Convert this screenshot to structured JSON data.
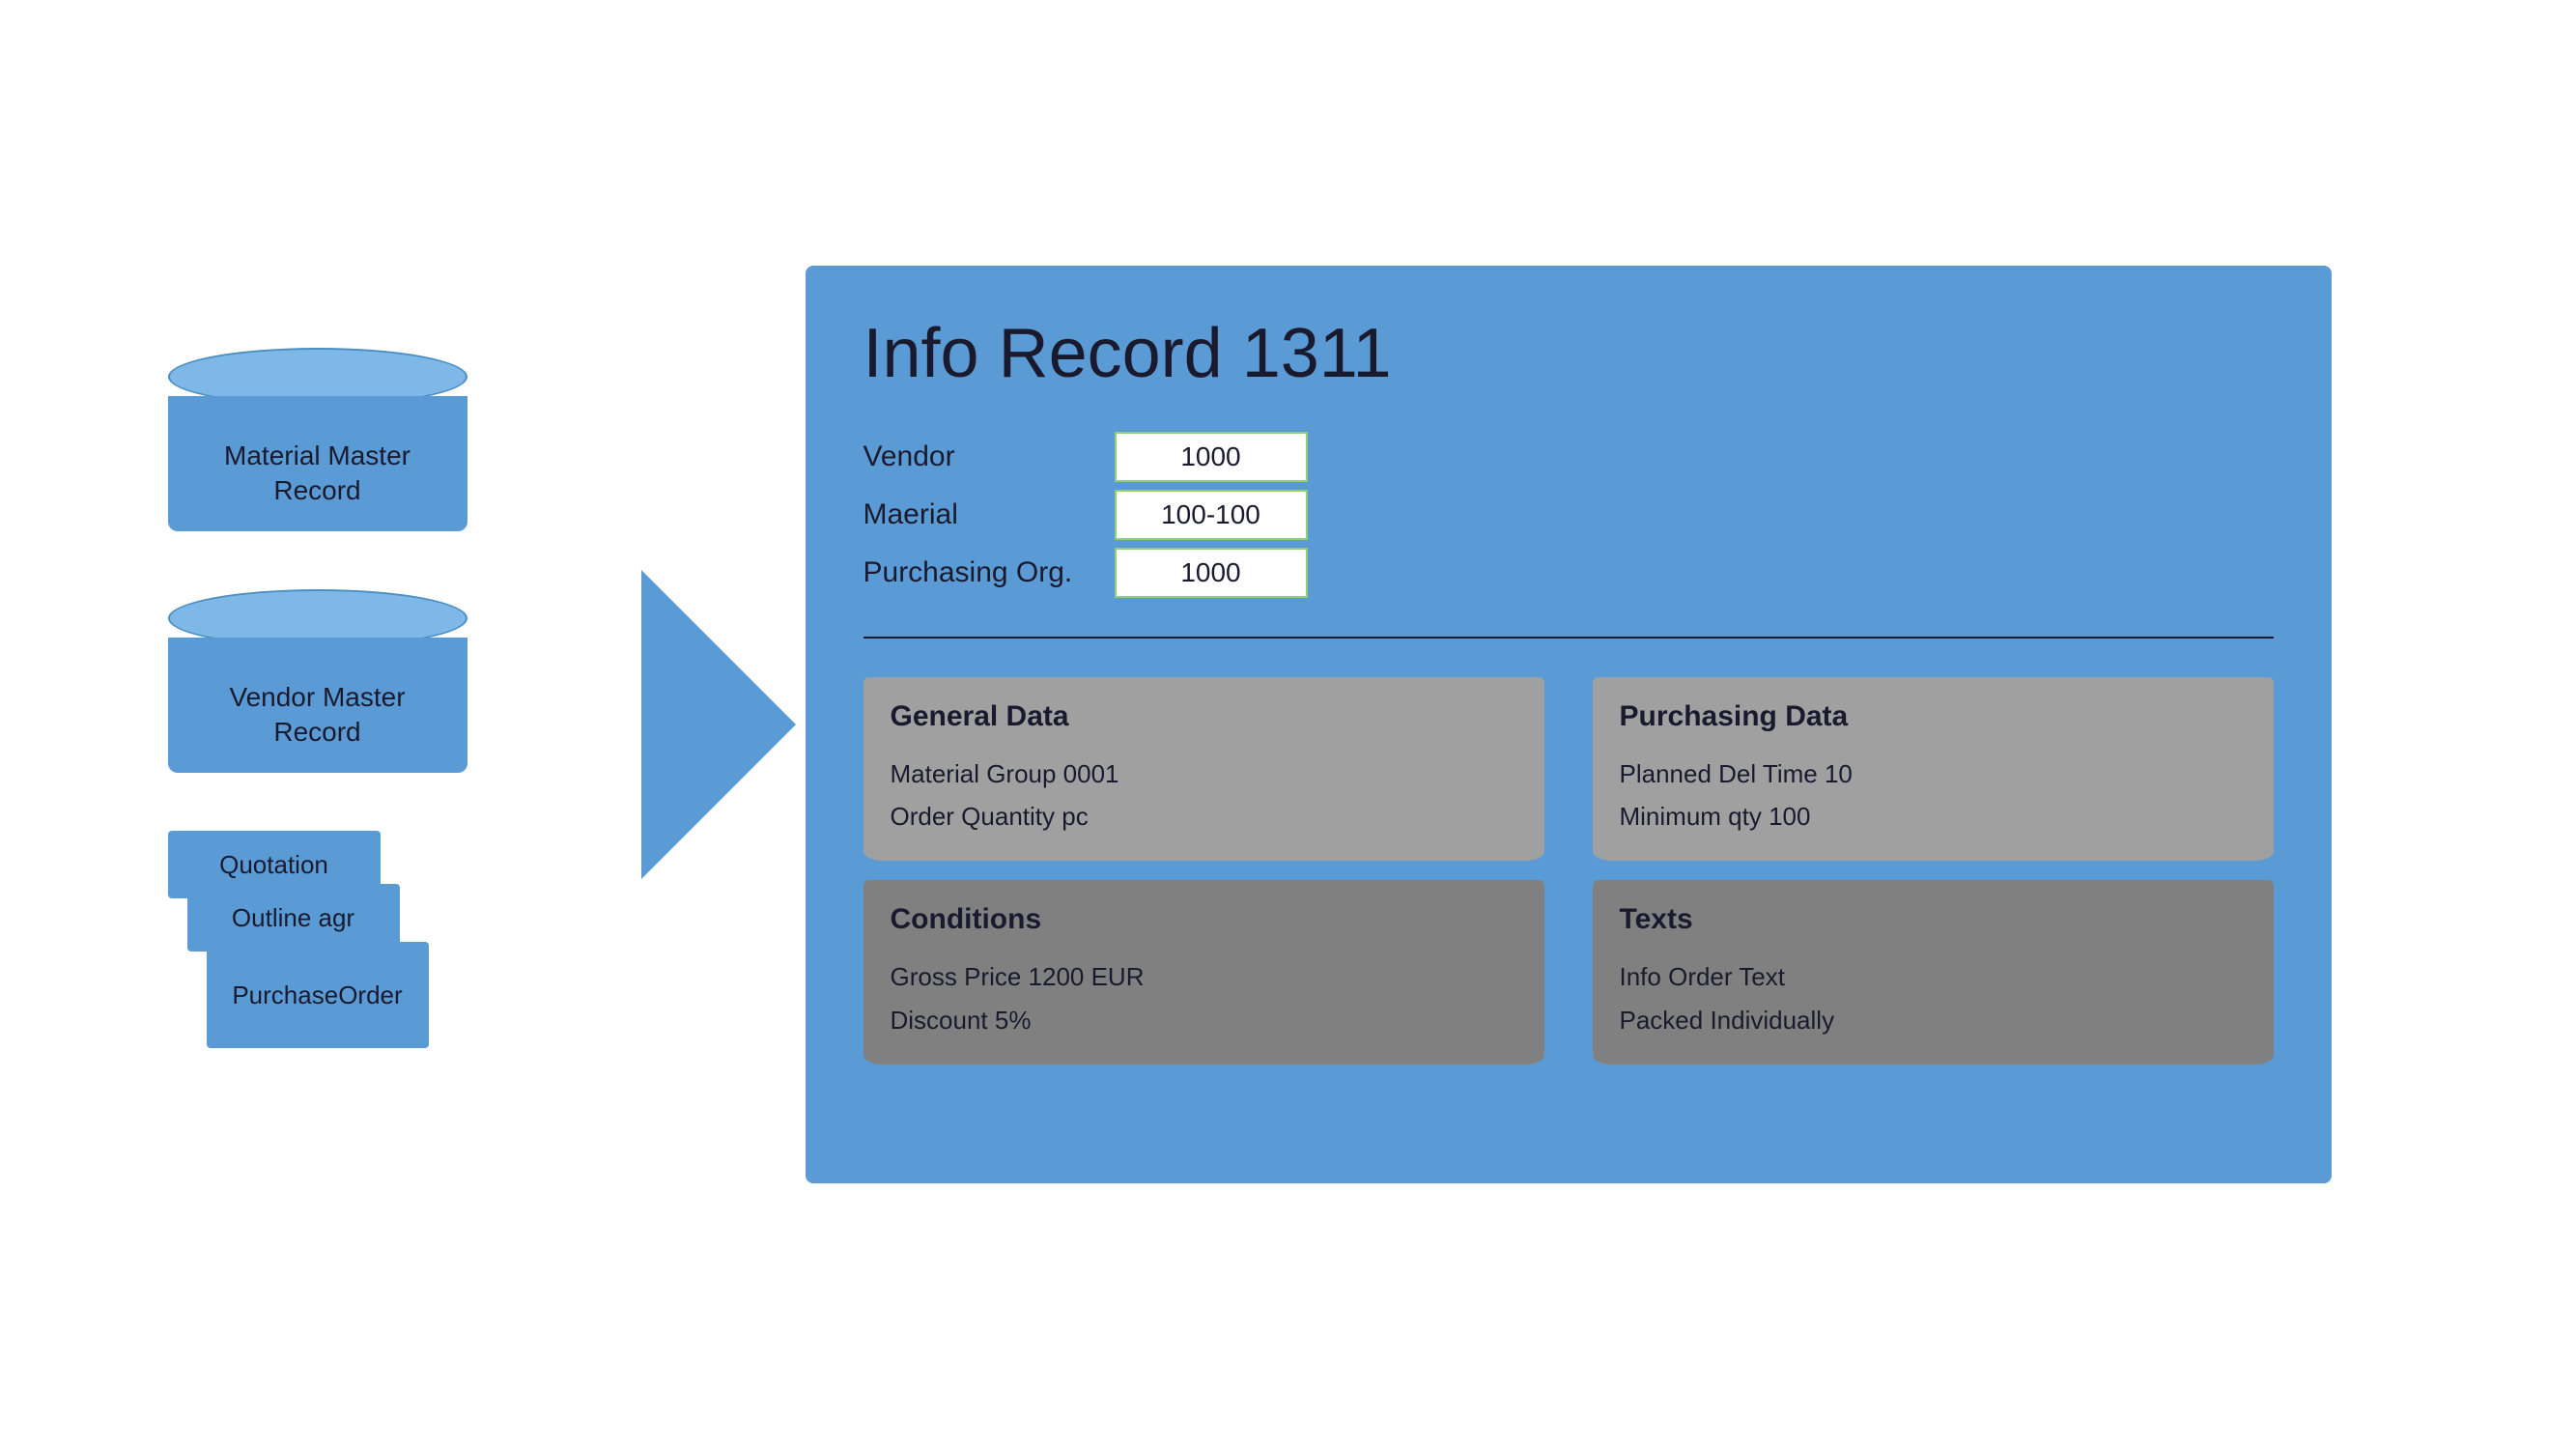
{
  "left": {
    "material_master": {
      "line1": "Material Master",
      "line2": "Record"
    },
    "vendor_master": {
      "line1": "Vendor Master",
      "line2": "Record"
    },
    "papers": {
      "quotation": "Quotation",
      "outline": "Outline agr",
      "purchase_line1": "Purchase",
      "purchase_line2": "Order"
    }
  },
  "info_record": {
    "title": "Info Record 1311",
    "fields": {
      "vendor_label": "Vendor",
      "vendor_value": "1000",
      "material_label": "Maerial",
      "material_value": "100-100",
      "purchasing_label": "Purchasing Org.",
      "purchasing_value": "1000"
    },
    "general_data": {
      "title": "General Data",
      "material_group": "Material Group 0001",
      "order_quantity": "Order Quantity   pc"
    },
    "conditions": {
      "title": "Conditions",
      "gross_price": "Gross Price    1200 EUR",
      "discount": "Discount         5%"
    },
    "purchasing_data": {
      "title": "Purchasing Data",
      "planned_del": "Planned Del Time 10",
      "minimum_qty": "Minimum qty    100"
    },
    "texts": {
      "title": "Texts",
      "info_order": "Info Order Text",
      "packed": "Packed Individually"
    }
  },
  "colors": {
    "blue": "#5b9bd5",
    "blue_light": "#7db8e8",
    "gray": "#a0a0a0",
    "dark_gray": "#808080",
    "text_dark": "#1a1a2e",
    "white": "#ffffff",
    "green_border": "#90d070"
  }
}
